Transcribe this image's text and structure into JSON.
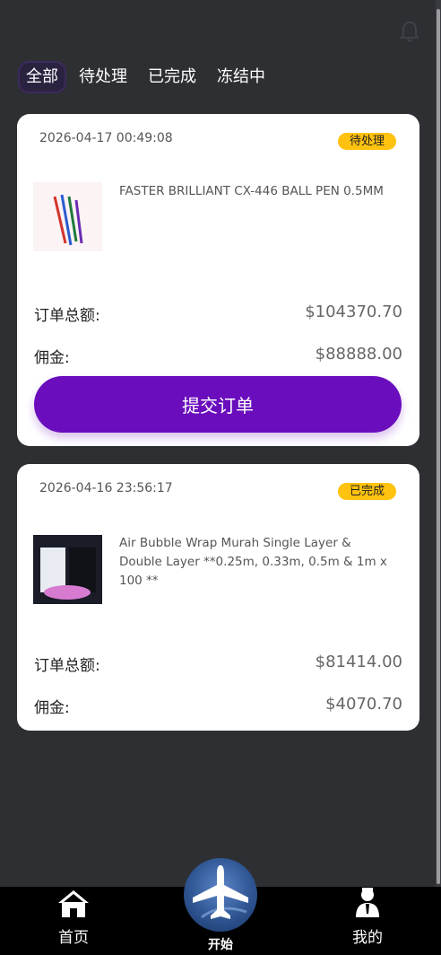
{
  "tabs": [
    {
      "label": "全部",
      "active": true
    },
    {
      "label": "待处理",
      "active": false
    },
    {
      "label": "已完成",
      "active": false
    },
    {
      "label": "冻结中",
      "active": false
    }
  ],
  "orders": [
    {
      "date": "2026-04-17 00:49:08",
      "status": "待处理",
      "product_name": "FASTER BRILLIANT CX-446 BALL PEN 0.5MM",
      "thumb_caption": "Faster Brilliant Ball Pen 0.5mm",
      "total_label": "订单总额:",
      "total_value": "$104370.70",
      "commission_label": "佣金:",
      "commission_value": "$88888.00",
      "submit_label": "提交订单"
    },
    {
      "date": "2026-04-16 23:56:17",
      "status": "已完成",
      "product_name": "Air Bubble Wrap Murah Single Layer & Double Layer **0.25m, 0.33m, 0.5m & 1m x 100 **",
      "thumb_caption": "Bubble Wrap",
      "total_label": "订单总额:",
      "total_value": "$81414.00",
      "commission_label": "佣金:",
      "commission_value": "$4070.70"
    }
  ],
  "nav": {
    "home": "首页",
    "start": "开始",
    "mine": "我的"
  },
  "colors": {
    "background": "#2e2f33",
    "accent": "#6a0dbd",
    "badge": "#ffc20e"
  }
}
